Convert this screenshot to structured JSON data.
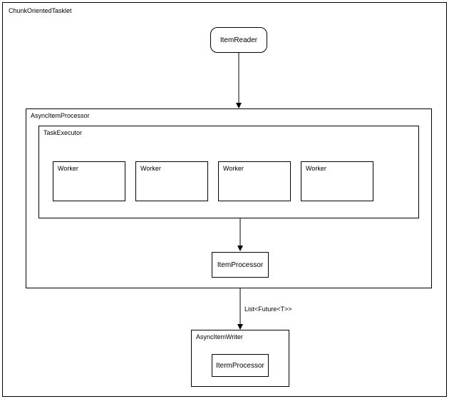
{
  "outer": {
    "label": "ChunkOrientedTasklet"
  },
  "reader": {
    "label": "ItemReader"
  },
  "asyncProcessor": {
    "label": "AsyncItemProcessor"
  },
  "taskExecutor": {
    "label": "TaskExecutor"
  },
  "workers": [
    "Worker",
    "Worker",
    "Worker",
    "Worker"
  ],
  "itemProcessor": {
    "label": "ItemProcessor"
  },
  "edgeLabel": "List<Future<T>>",
  "asyncWriter": {
    "label": "AsyncItemWriter"
  },
  "itermProcessor": {
    "label": "ItermProcessor"
  },
  "chart_data": {
    "type": "diagram",
    "title": "ChunkOrientedTasklet",
    "nodes": [
      {
        "id": "chunk-oriented-tasklet",
        "label": "ChunkOrientedTasklet",
        "kind": "container"
      },
      {
        "id": "item-reader",
        "label": "ItemReader",
        "kind": "rounded-box",
        "parent": "chunk-oriented-tasklet"
      },
      {
        "id": "async-item-processor",
        "label": "AsyncItemProcessor",
        "kind": "container",
        "parent": "chunk-oriented-tasklet"
      },
      {
        "id": "task-executor",
        "label": "TaskExecutor",
        "kind": "container",
        "parent": "async-item-processor"
      },
      {
        "id": "worker-1",
        "label": "Worker",
        "kind": "box",
        "parent": "task-executor"
      },
      {
        "id": "worker-2",
        "label": "Worker",
        "kind": "box",
        "parent": "task-executor"
      },
      {
        "id": "worker-3",
        "label": "Worker",
        "kind": "box",
        "parent": "task-executor"
      },
      {
        "id": "worker-4",
        "label": "Worker",
        "kind": "box",
        "parent": "task-executor"
      },
      {
        "id": "item-processor",
        "label": "ItemProcessor",
        "kind": "box",
        "parent": "async-item-processor"
      },
      {
        "id": "async-item-writer",
        "label": "AsyncItemWriter",
        "kind": "container",
        "parent": "chunk-oriented-tasklet"
      },
      {
        "id": "iterm-processor",
        "label": "ItermProcessor",
        "kind": "box",
        "parent": "async-item-writer"
      }
    ],
    "edges": [
      {
        "from": "item-reader",
        "to": "async-item-processor",
        "label": ""
      },
      {
        "from": "task-executor",
        "to": "item-processor",
        "label": ""
      },
      {
        "from": "async-item-processor",
        "to": "async-item-writer",
        "label": "List<Future<T>>"
      }
    ]
  }
}
